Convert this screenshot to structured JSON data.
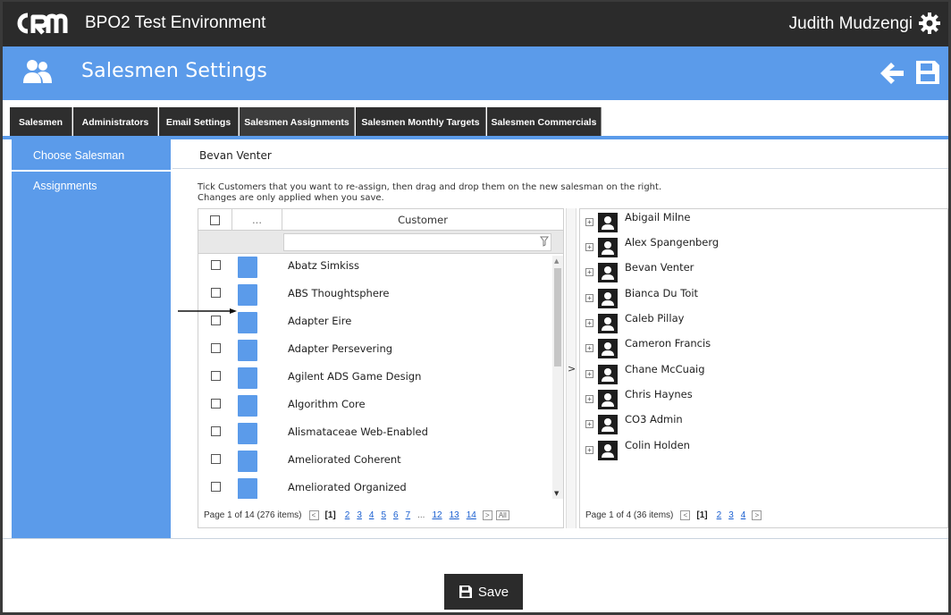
{
  "app": {
    "title": "BPO2 Test Environment",
    "user_name": "Judith Mudzengi"
  },
  "header": {
    "title": "Salesmen Settings"
  },
  "tabs": [
    {
      "label": "Salesmen"
    },
    {
      "label": "Administrators"
    },
    {
      "label": "Email Settings"
    },
    {
      "label": "Salesmen Assignments",
      "active": true
    },
    {
      "label": "Salesmen Monthly Targets"
    },
    {
      "label": "Salesmen Commercials"
    }
  ],
  "sidebar": {
    "items": [
      {
        "label": "Choose Salesman"
      },
      {
        "label": "Assignments"
      }
    ]
  },
  "selected_salesman": "Bevan Venter",
  "instructions": {
    "line1": "Tick Customers that you want to re-assign, then drag and drop them on the new salesman on the right.",
    "line2": "Changes are only applied when you save."
  },
  "customer_grid": {
    "col_dots": "...",
    "col_customer": "Customer",
    "filter_value": "",
    "rows": [
      "Abatz Simkiss",
      "ABS Thoughtsphere",
      "Adapter Eire",
      "Adapter Persevering",
      "Agilent ADS Game Design",
      "Algorithm Core",
      "Alismataceae Web-Enabled",
      "Ameliorated Coherent",
      "Ameliorated Organized"
    ],
    "pager": {
      "summary": "Page 1 of 14 (276 items)",
      "current": "[1]",
      "pages": [
        "2",
        "3",
        "4",
        "5",
        "6",
        "7",
        "...",
        "12",
        "13",
        "14"
      ],
      "all": "All"
    }
  },
  "splitter_arrow": ">",
  "salesman_tree": {
    "nodes": [
      "Abigail Milne",
      "Alex Spangenberg",
      "Bevan Venter",
      "Bianca Du Toit",
      "Caleb Pillay",
      "Cameron Francis",
      "Chane McCuaig",
      "Chris Haynes",
      "CO3 Admin",
      "Colin Holden"
    ],
    "pager": {
      "summary": "Page 1 of 4 (36 items)",
      "current": "[1]",
      "pages": [
        "2",
        "3",
        "4"
      ]
    }
  },
  "save_button": {
    "label": "Save"
  },
  "colors": {
    "accent": "#5b9bea",
    "dark": "#2b2b2b"
  }
}
